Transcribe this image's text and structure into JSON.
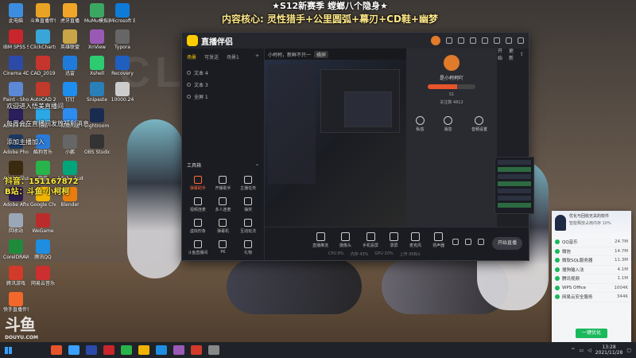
{
  "banner": {
    "line1": "★S12新赛季 螳螂八个隐身★",
    "line2": "内容核心: 灵性猎手+公里圆弧+幕刃+CD鞋+幽梦"
  },
  "overlay": {
    "welcome1": "欢迎进入悟美直播间",
    "welcome2": "每周会在直播间发放福利消息",
    "fans": "添加主播加入",
    "douyin_label": "抖音：151167872",
    "bili_label": "B站：斗鱼·小柯柯"
  },
  "desktop_icons": [
    {
      "label": "此电脑",
      "color": "#3b8de0"
    },
    {
      "label": "IBM SPSS Statistics 21",
      "color": "#c8262c"
    },
    {
      "label": "Cinema 4D",
      "color": "#2c4aa8"
    },
    {
      "label": "Paint - Shop",
      "color": "#5b89d6"
    },
    {
      "label": "Adobe Premiere",
      "color": "#2a1f5c"
    },
    {
      "label": "Adobe Photoshop",
      "color": "#1c3a63"
    },
    {
      "label": "Adobe Illustrator",
      "color": "#3a2a10"
    },
    {
      "label": "Adobe After",
      "color": "#2c1d4d"
    },
    {
      "label": "回收站",
      "color": "#9aa7b7"
    },
    {
      "label": "CorelDRAW 2020",
      "color": "#1f8a3b"
    },
    {
      "label": "腾讯游戏",
      "color": "#d23a2a"
    },
    {
      "label": "快手直播伴侣",
      "color": "#f2672a"
    },
    {
      "label": "斗鱼直播伴侣",
      "color": "#e8a324"
    },
    {
      "label": "ClickCharts",
      "color": "#3aa5d8"
    },
    {
      "label": "CAD_2019",
      "color": "#c6352d"
    },
    {
      "label": "AutoCAD 2019",
      "color": "#c0392b"
    },
    {
      "label": "优酷",
      "color": "#2da8e6"
    },
    {
      "label": "酷狗音乐",
      "color": "#2a7bd8"
    },
    {
      "label": "微信",
      "color": "#29b34b"
    },
    {
      "label": "Google Chrome",
      "color": "#f0b400"
    },
    {
      "label": "WeGame",
      "color": "#bb2b2b"
    },
    {
      "label": "腾讯QQ",
      "color": "#1f8de0"
    },
    {
      "label": "网易云音乐",
      "color": "#cc2f2f"
    },
    {
      "label": "虎牙直播",
      "color": "#f0a629"
    },
    {
      "label": "英雄联盟",
      "color": "#c9a548"
    },
    {
      "label": "迅雷",
      "color": "#1f7bdb"
    },
    {
      "label": "钉钉",
      "color": "#1d8ef0"
    },
    {
      "label": "百度网盘",
      "color": "#2d8cf0"
    },
    {
      "label": "小鹏",
      "color": "#666666"
    },
    {
      "label": "Adobe Audition",
      "color": "#00a57b"
    },
    {
      "label": "Blender",
      "color": "#e87d0d"
    },
    {
      "label": "MuMu模拟器",
      "color": "#3aa860"
    },
    {
      "label": "XnView",
      "color": "#9b59b6"
    },
    {
      "label": "Xshell",
      "color": "#2ecc71"
    },
    {
      "label": "Snipaste",
      "color": "#2980b9"
    },
    {
      "label": "Lightroom",
      "color": "#1a2b50"
    },
    {
      "label": "OBS Studio",
      "color": "#333333"
    },
    {
      "label": "Microsoft Edge",
      "color": "#0f7bd8"
    },
    {
      "label": "Typora",
      "color": "#666666"
    },
    {
      "label": "Recovery",
      "color": "#1f5fbf"
    },
    {
      "label": "10000.24",
      "color": "#cccccc"
    }
  ],
  "app": {
    "name": "直播伴侣",
    "sidebar_tabs": [
      "场景",
      "可发送",
      "场景1"
    ],
    "scenes": [
      "文本 4",
      "文本 3",
      "全屏 1"
    ],
    "tools_label": "工具箱",
    "tools": [
      "弹幕助手",
      "开播助手",
      "主播任务",
      "视频连麦",
      "多人连麦",
      "抽奖",
      "虚拟形象",
      "弹幕机",
      "互动玩法",
      "斗鱼直播间",
      "PK",
      "礼物"
    ],
    "preview_title": "小柯柯，新鲜不只一",
    "preview_badge": "横屏",
    "stats": [
      "4",
      "1253",
      "88"
    ],
    "profile": {
      "name": "是小柯柯吖",
      "level_label": "S1",
      "level_progress": 0.62,
      "meta": "关注数 4812",
      "buttons": [
        "私信",
        "消息",
        "音频设置"
      ]
    },
    "right_header": [
      "开始",
      "更新"
    ],
    "bottom_items": [
      "直播推流",
      "摄像头",
      "手机投屏",
      "录屏",
      "麦克风",
      "扬声器"
    ],
    "status": [
      "CPU 8%",
      "内存 43%",
      "GPU 20%",
      "上传 0KB/s"
    ],
    "go_live": "开始直播"
  },
  "widget": {
    "title": "优化与回收无关的软件",
    "subtitle": "智能释放占用内存 10%",
    "rows": [
      {
        "name": "QQ音乐",
        "size": "24.7M"
      },
      {
        "name": "微信",
        "size": "14.7M"
      },
      {
        "name": "微软SQL服务器",
        "size": "11.3M"
      },
      {
        "name": "搜狗输入法",
        "size": "4.1M"
      },
      {
        "name": "腾讯视频",
        "size": "1.1M"
      },
      {
        "name": "WPS Office",
        "size": "1004K"
      },
      {
        "name": "网易云安全服务",
        "size": "344K"
      }
    ],
    "button": "一键优化"
  },
  "taskbar": {
    "time": "13:28",
    "date": "2021/11/28",
    "apps": [
      "#e8542b",
      "#3ba0ff",
      "#2c4aa8",
      "#c8262c",
      "#29b34b",
      "#f0b400",
      "#1f8de0",
      "#9b59b6",
      "#d23a2a",
      "#888888"
    ]
  },
  "watermark": {
    "logo": "斗鱼",
    "site": "DOUYU.COM"
  }
}
